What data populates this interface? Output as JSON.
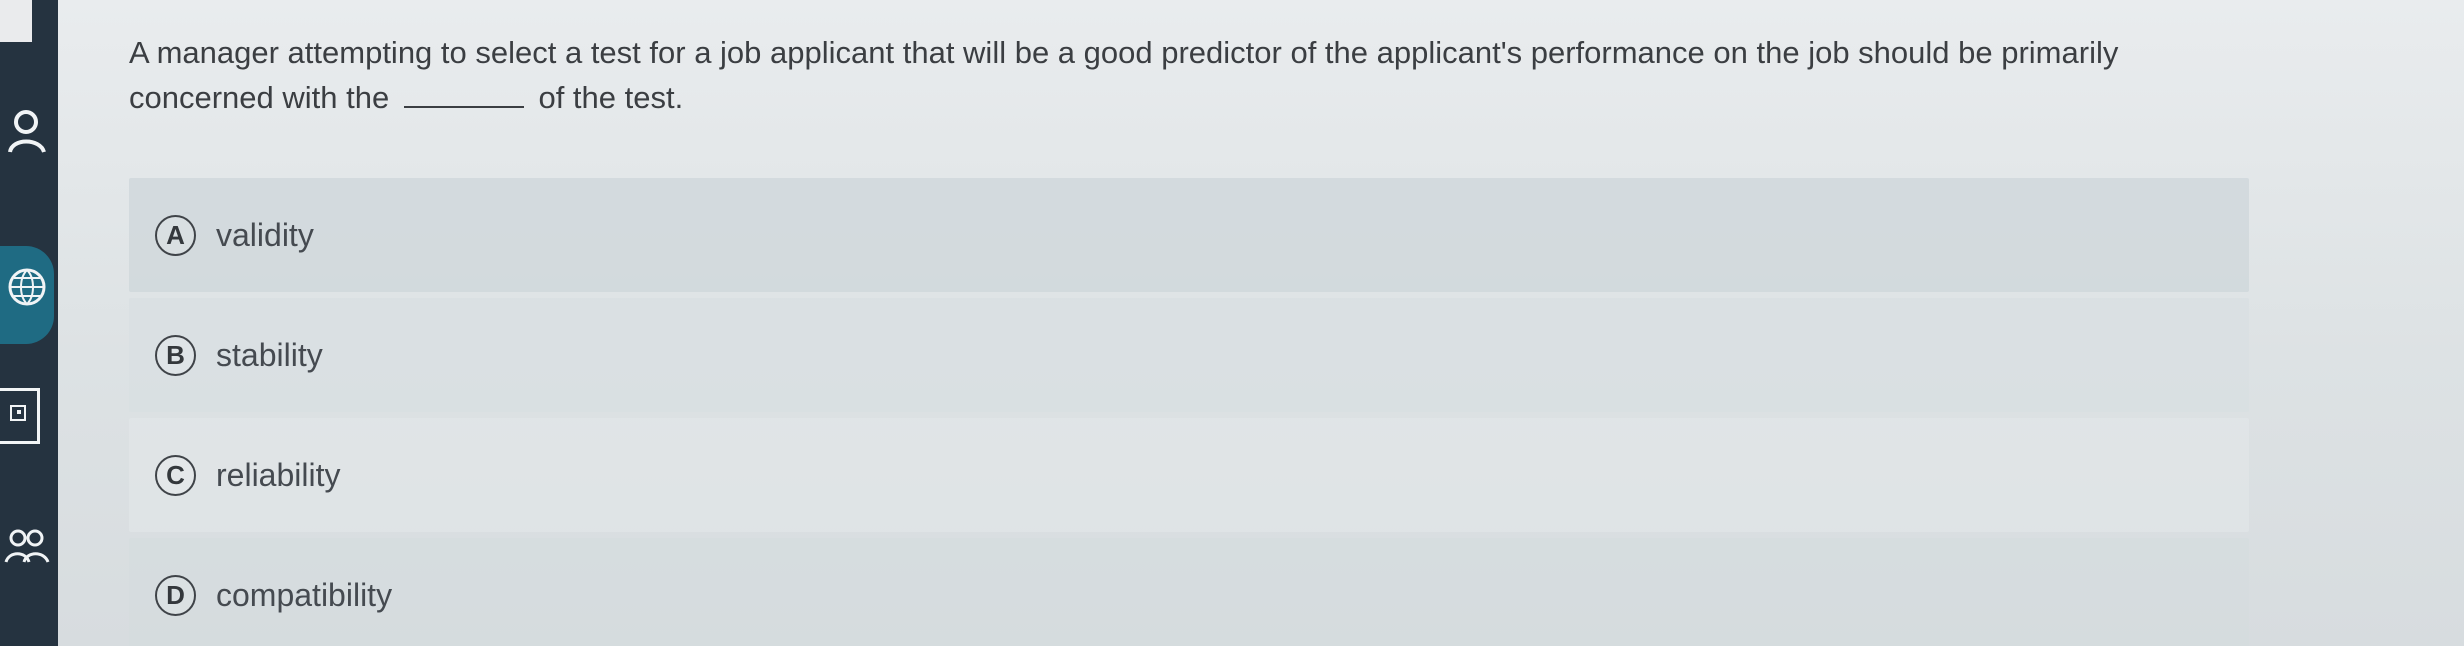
{
  "question": {
    "before_blank": "A manager attempting to select a test for a job applicant that will be a good predictor of the applicant's performance on the job should be primarily concerned with the",
    "after_blank": "of the test."
  },
  "options": [
    {
      "letter": "A",
      "label": "validity"
    },
    {
      "letter": "B",
      "label": "stability"
    },
    {
      "letter": "C",
      "label": "reliability"
    },
    {
      "letter": "D",
      "label": "compatibility"
    }
  ],
  "rail": {
    "icons": [
      "menu-icon",
      "user-icon",
      "globe-icon",
      "document-icon",
      "people-icon"
    ]
  }
}
